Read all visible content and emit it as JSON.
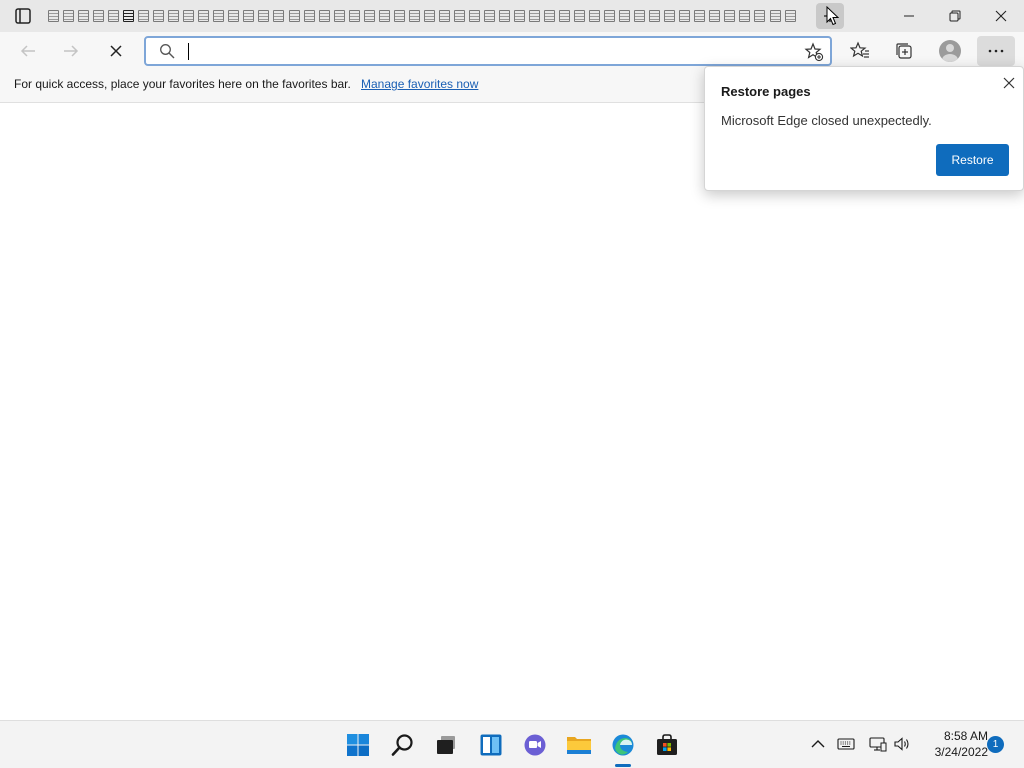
{
  "titlebar": {
    "tab_count": 50,
    "active_tab_index": 5,
    "icons": [
      "tab-actions-icon",
      "new-tab-icon",
      "minimize-icon",
      "restore-window-icon",
      "close-window-icon"
    ]
  },
  "toolbar": {
    "address_value": "",
    "address_placeholder": "",
    "icons": [
      "back-icon",
      "forward-icon",
      "stop-loading-icon",
      "search-icon",
      "add-favorite-icon",
      "favorites-icon",
      "collections-icon",
      "profile-avatar",
      "more-icon"
    ]
  },
  "favorites_bar": {
    "message": "For quick access, place your favorites here on the favorites bar.",
    "link_label": "Manage favorites now"
  },
  "popup": {
    "title": "Restore pages",
    "message": "Microsoft Edge closed unexpectedly.",
    "button_label": "Restore"
  },
  "taskbar": {
    "apps": [
      "start-icon",
      "search-icon",
      "task-view-icon",
      "widgets-icon",
      "chat-icon",
      "file-explorer-icon",
      "edge-icon",
      "store-icon"
    ],
    "tray": [
      "show-hidden-icons",
      "keyboard-icon",
      "network-icon",
      "volume-icon"
    ],
    "time": "8:58 AM",
    "date": "3/24/2022",
    "notification_count": "1"
  },
  "colors": {
    "accent": "#0f6cbd",
    "link": "#1a5fb4",
    "titlebar_bg": "#e8e8e8",
    "toolbar_bg": "#f7f7f7",
    "taskbar_bg": "#f3f3f3"
  }
}
